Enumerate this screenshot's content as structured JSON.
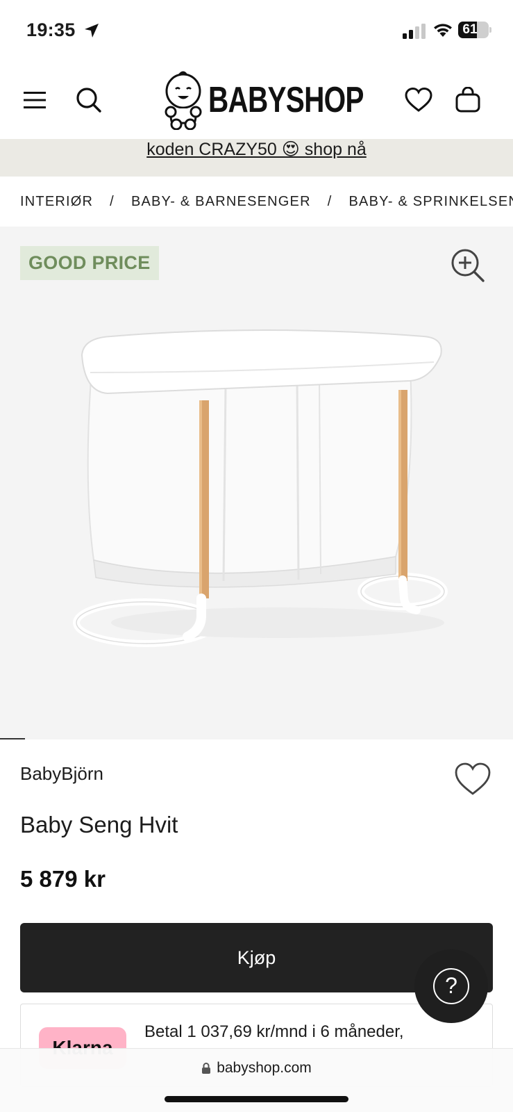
{
  "status_bar": {
    "time": "19:35",
    "battery": "61",
    "battery_level": 0.61,
    "icons": [
      "location-arrow-icon",
      "cellular-signal-icon",
      "wifi-icon",
      "battery-icon"
    ]
  },
  "header": {
    "logo_text": "BABYSHOP",
    "icons": [
      "menu-icon",
      "search-icon",
      "heart-icon",
      "shopping-bag-icon"
    ]
  },
  "promo": {
    "text": "koden CRAZY50 😍 shop nå"
  },
  "breadcrumb": {
    "items": [
      "INTERIØR",
      "BABY- & BARNESENGER",
      "BABY- & SPRINKELSENGER"
    ],
    "separator": "/"
  },
  "gallery": {
    "badge": "GOOD PRICE",
    "badge_color": "#6f8d5c",
    "badge_bg": "#e1eadb",
    "zoom_icon": "zoom-in-icon",
    "image": "baby-crib-image"
  },
  "product": {
    "brand": "BabyBjörn",
    "name": "Baby Seng Hvit",
    "price": "5 879 kr",
    "buy_label": "Kjøp",
    "wishlist_icon": "heart-icon"
  },
  "klarna": {
    "logo": "Klarna",
    "text": "Betal 1 037,69 kr/mnd i 6 måneder,"
  },
  "help": {
    "label": "?"
  },
  "browser": {
    "url": "babyshop.com"
  }
}
